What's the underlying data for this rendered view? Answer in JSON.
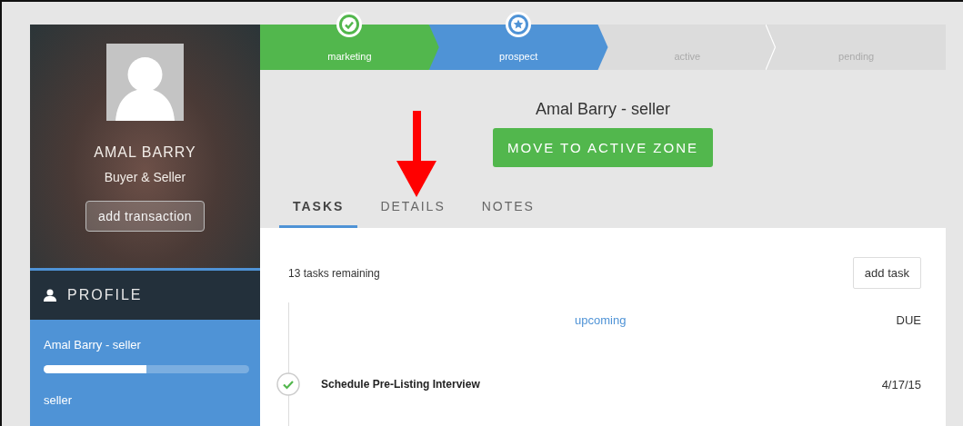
{
  "contact": {
    "name": "AMAL BARRY",
    "role": "Buyer & Seller",
    "action": "add transaction"
  },
  "profile": {
    "heading": "PROFILE",
    "transaction": {
      "title": "Amal Barry - seller",
      "level": 0.5,
      "type": "seller",
      "selected": true
    }
  },
  "stages": [
    {
      "label": "marketing",
      "kind": "done"
    },
    {
      "label": "prospect",
      "kind": "current"
    },
    {
      "label": "active",
      "kind": "upcoming"
    },
    {
      "label": "pending",
      "kind": "upcoming"
    }
  ],
  "title": "Amal Barry - seller",
  "primary_button": "MOVE TO ACTIVE ZONE",
  "tabs": [
    {
      "label": "TASKS",
      "selected": true
    },
    {
      "label": "DETAILS",
      "selected": false
    },
    {
      "label": "NOTES",
      "selected": false
    }
  ],
  "tasks": {
    "remaining": "13 tasks remaining",
    "add_button": "add task",
    "group": "upcoming",
    "due_heading": "DUE",
    "items": [
      {
        "title": "Schedule Pre-Listing Interview",
        "due": "4/17/15",
        "checked": true
      }
    ]
  }
}
